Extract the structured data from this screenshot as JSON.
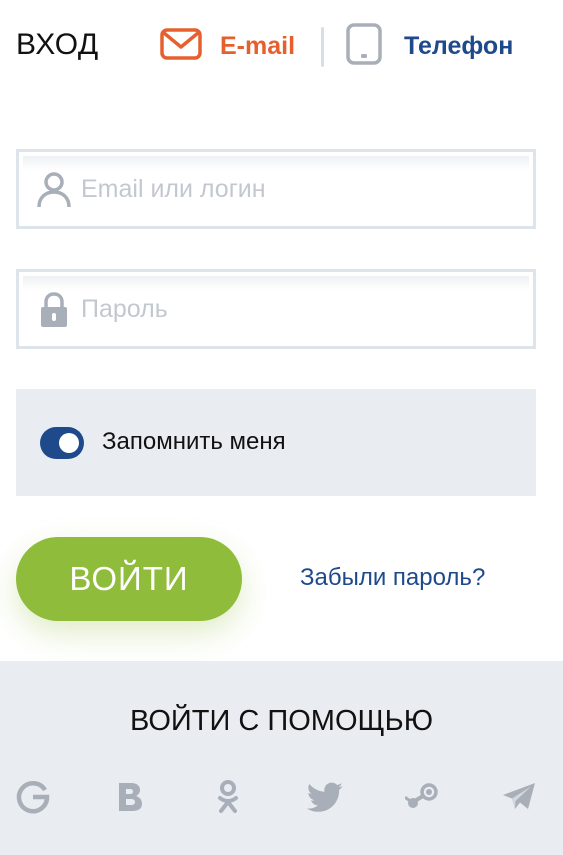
{
  "header": {
    "title": "ВХОД",
    "tabs": [
      {
        "label": "E-mail",
        "icon": "envelope-icon",
        "color": "#e5602e",
        "active": true
      },
      {
        "label": "Телефон",
        "icon": "phone-icon",
        "color": "#1e4a8c",
        "active": false
      }
    ]
  },
  "form": {
    "login": {
      "placeholder": "Email или логин",
      "value": "",
      "icon": "user-icon"
    },
    "password": {
      "placeholder": "Пароль",
      "value": "",
      "icon": "lock-icon"
    },
    "remember": {
      "label": "Запомнить меня",
      "checked": true
    },
    "submit_label": "ВОЙТИ",
    "forgot_label": "Забыли пароль?"
  },
  "social": {
    "title": "ВОЙТИ С ПОМОЩЬЮ",
    "providers": [
      {
        "name": "google",
        "icon": "google-icon"
      },
      {
        "name": "vkontakte",
        "icon": "vk-icon"
      },
      {
        "name": "odnoklassniki",
        "icon": "odnoklassniki-icon"
      },
      {
        "name": "twitter",
        "icon": "twitter-icon"
      },
      {
        "name": "steam",
        "icon": "steam-icon"
      },
      {
        "name": "telegram",
        "icon": "telegram-icon"
      }
    ]
  },
  "colors": {
    "accent_orange": "#e5602e",
    "accent_blue": "#1e4a8c",
    "button_green": "#8fbc3a",
    "panel_gray": "#e9ecf0",
    "icon_gray": "#a9afb9"
  }
}
